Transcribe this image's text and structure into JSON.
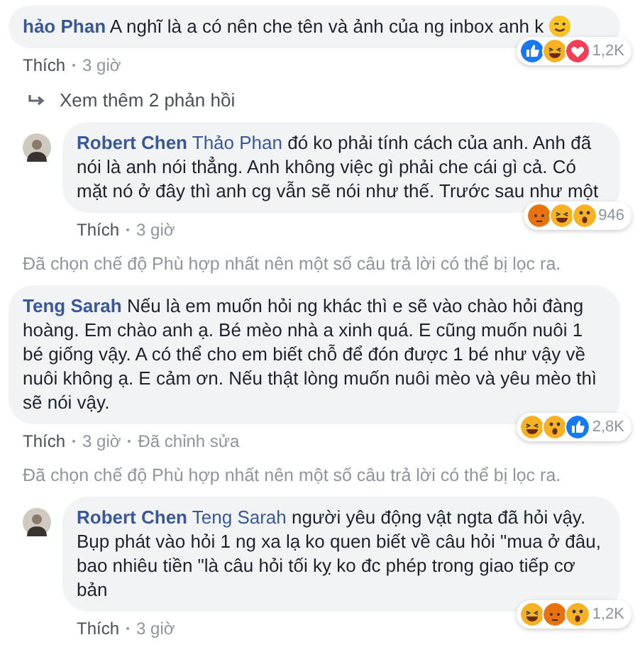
{
  "items": [
    {
      "kind": "comment",
      "reply": false,
      "author": "hảo Phan",
      "text": "A nghĩ là a có nên che tên và ảnh của ng inbox anh k",
      "wink_emoji": true,
      "reactions": [
        {
          "kind": "like"
        },
        {
          "kind": "haha"
        },
        {
          "kind": "love"
        }
      ],
      "reaction_count": "1,2K",
      "meta": [
        "Thích",
        "3 giờ"
      ]
    },
    {
      "kind": "more_replies",
      "text": "Xem thêm 2 phản hồi"
    },
    {
      "kind": "comment",
      "reply": true,
      "author": "Robert Chen",
      "mention": "Thảo Phan",
      "text": "đó ko phải tính cách của anh. Anh đã nói là anh nói thẳng. Anh không việc gì phải che cái gì cả. Có mặt nó ở đây thì anh cg vẫn sẽ nói như thế. Trước sau như một",
      "wink_emoji": false,
      "reactions": [
        {
          "kind": "angry"
        },
        {
          "kind": "haha"
        },
        {
          "kind": "wow"
        }
      ],
      "reaction_count": "946",
      "meta": [
        "Thích",
        "3 giờ"
      ]
    },
    {
      "kind": "filter_notice",
      "text": "Đã chọn chế độ Phù hợp nhất nên một số câu trả lời có thể bị lọc ra."
    },
    {
      "kind": "comment",
      "reply": false,
      "author": "Teng Sarah",
      "text": "Nếu là em muốn hỏi ng khác thì e sẽ vào chào hỏi đàng hoàng. Em chào anh ạ. Bé mèo nhà a xinh quá. E cũng muốn nuôi 1 bé giống vậy. A có thể cho em biết chỗ để đón được 1 bé như vậy về nuôi không ạ. E cảm ơn. Nếu thật lòng muốn nuôi mèo và yêu mèo thì sẽ nói vậy.",
      "wink_emoji": false,
      "reactions": [
        {
          "kind": "haha"
        },
        {
          "kind": "wow"
        },
        {
          "kind": "like"
        }
      ],
      "reaction_count": "2,8K",
      "meta": [
        "Thích",
        "3 giờ",
        "Đã chỉnh sửa"
      ]
    },
    {
      "kind": "filter_notice",
      "text": "Đã chọn chế độ Phù hợp nhất nên một số câu trả lời có thể bị lọc ra."
    },
    {
      "kind": "comment",
      "reply": true,
      "author": "Robert Chen",
      "mention": "Teng Sarah",
      "text": "người yêu động vật ngta đã hỏi vậy. Bụp phát vào hỏi 1 ng xa lạ ko quen biết về câu hỏi \"mua ở đâu, bao nhiêu tiền \"là câu hỏi tối kỵ ko đc phép trong giao tiếp cơ bản",
      "wink_emoji": false,
      "reactions": [
        {
          "kind": "haha"
        },
        {
          "kind": "angry"
        },
        {
          "kind": "wow"
        }
      ],
      "reaction_count": "1,2K",
      "meta": [
        "Thích",
        "3 giờ"
      ]
    }
  ]
}
